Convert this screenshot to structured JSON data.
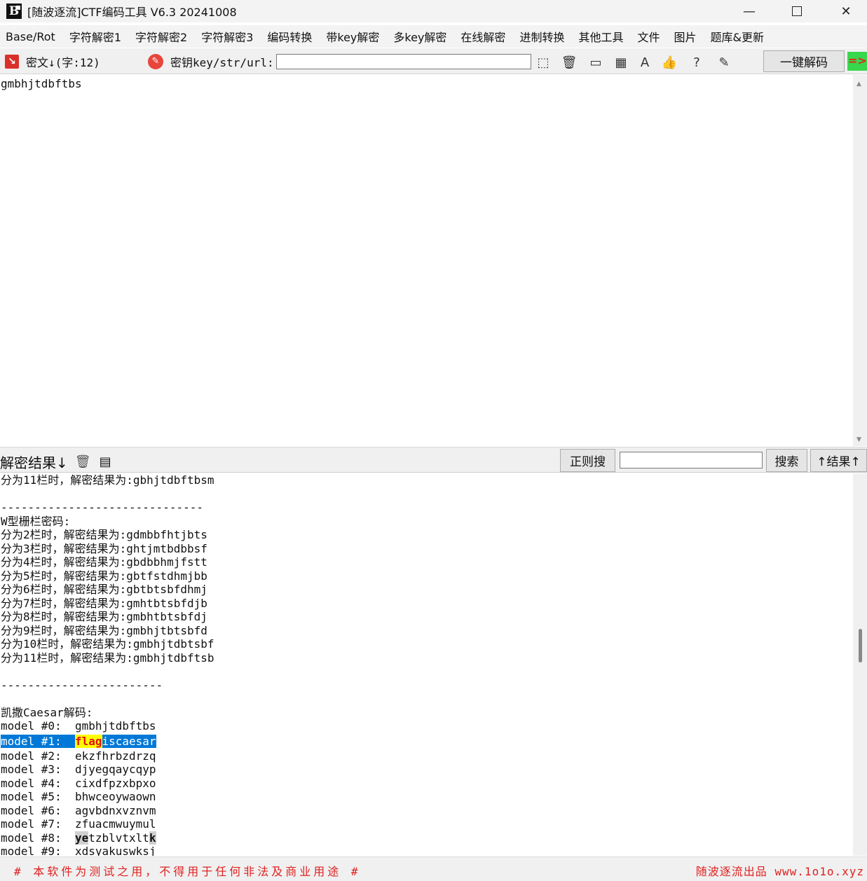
{
  "window": {
    "title": "[随波逐流]CTF编码工具 V6.3 20241008",
    "logo_text": "B",
    "min_symbol": "—",
    "close_symbol": "✕"
  },
  "menu": [
    "Base/Rot",
    "字符解密1",
    "字符解密2",
    "字符解密3",
    "编码转换",
    "带key解密",
    "多key解密",
    "在线解密",
    "进制转换",
    "其他工具",
    "文件",
    "图片",
    "题库&更新"
  ],
  "toolbar": {
    "cipher_label": "密文↓(字:12)",
    "key_label": "密钥key/str/url:",
    "key_value": "",
    "one_click_label": "一键解码",
    "indicator": "=>",
    "icons": [
      "select-icon",
      "trash-icon",
      "terminal-icon",
      "calculator-icon",
      "font-icon",
      "thumbs-up-icon",
      "help-icon",
      "edit-icon"
    ]
  },
  "cipher": {
    "text": "gmbhjtdbftbs"
  },
  "result_bar": {
    "label": "解密结果↓",
    "regex_label": "正则搜",
    "regex_value": "",
    "search_label": "搜索",
    "top_label": "↑结果↑"
  },
  "results": {
    "lines": [
      "分为11栏时，解密结果为:gbhjtdbftbsm",
      "",
      "------------------------------",
      "W型栅栏密码:",
      "分为2栏时，解密结果为:gdmbbfhtjbts",
      "分为3栏时，解密结果为:ghtjmtbdbbsf",
      "分为4栏时，解密结果为:gbdbbhmjfstt",
      "分为5栏时，解密结果为:gbtfstdhmjbb",
      "分为6栏时，解密结果为:gbtbtsbfdhmj",
      "分为7栏时，解密结果为:gmhtbtsbfdjb",
      "分为8栏时，解密结果为:gmbhtbtsbfdj",
      "分为9栏时，解密结果为:gmbhjtbtsbfd",
      "分为10栏时，解密结果为:gmbhjtdbtsbf",
      "分为11栏时，解密结果为:gmbhjtdbftsb",
      "",
      "------------------------",
      "",
      "凯撒Caesar解码:",
      "model #0:  gmbhjtdbftbs"
    ],
    "selected": {
      "prefix": "model #1:  ",
      "match": "flag",
      "rest": "iscaesar"
    },
    "after_lines": [
      "model #2:  ekzfhrbzdrzq",
      "model #3:  djyegqaycqyp",
      "model #4:  cixdfpzxbpxo",
      "model #5:  bhwceoywaown",
      "model #6:  agvbdnxvznvm",
      "model #7:  zfuacmwuymul"
    ],
    "line8": {
      "prefix": "model #8:  ",
      "head": "ye",
      "mid": "tzblvtxlt",
      "tail": "k"
    },
    "last_line": "model #9:  xdsyakuswksj"
  },
  "status": {
    "left": "# 本软件为测试之用，不得用于任何非法及商业用途 #",
    "right": "随波逐流出品 www.1o1o.xyz"
  },
  "colors": {
    "selection": "#0078d7",
    "highlight": "#ffff00",
    "match_text": "#e01010",
    "status_text": "#e02020",
    "indicator_bg": "#39d74d"
  }
}
